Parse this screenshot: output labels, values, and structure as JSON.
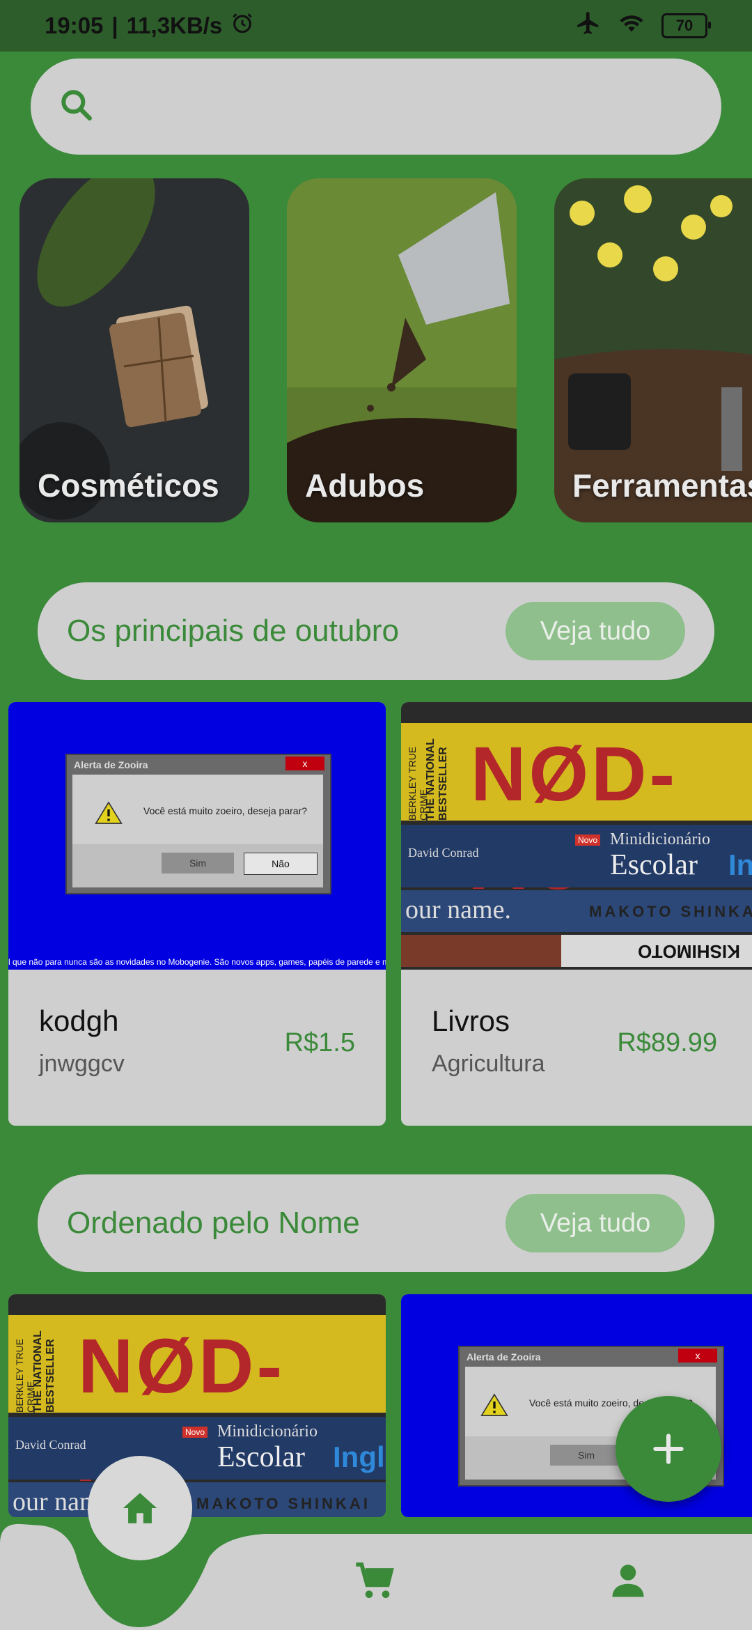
{
  "status_bar": {
    "time": "19:05",
    "speed": "11,3KB/s",
    "battery": "70",
    "icons": [
      "alarm-icon",
      "airplane-icon",
      "wifi-icon",
      "battery-icon"
    ]
  },
  "search": {
    "placeholder": "",
    "value": ""
  },
  "categories": [
    {
      "label": "Cosméticos"
    },
    {
      "label": "Adubos"
    },
    {
      "label": "Ferramentas"
    }
  ],
  "sections": [
    {
      "title": "Os principais de outubro",
      "see_all": "Veja tudo",
      "products": [
        {
          "name": "kodgh",
          "sub": "jnwggcv",
          "price": "R$1.5"
        },
        {
          "name": "Livros",
          "sub": "Agricultura",
          "price": "R$89.99"
        }
      ]
    },
    {
      "title": "Ordenado pelo Nome",
      "see_all": "Veja tudo"
    }
  ],
  "dialog_art": {
    "title": "Alerta de Zooira",
    "close": "x",
    "message": "Você está muito zoeiro, deseja parar?",
    "yes": "Sim",
    "no": "Não",
    "ticker": "l que não para nunca são as novidades no Mobogenie. São novos apps, games, papéis de parede e música todo dia!"
  },
  "books_art": {
    "spine1_tag": "BERKLEY TRUE CRIME",
    "spine1_banner": "THE NATIONAL BESTSELLER",
    "spine1_title": "NØD-AC",
    "spine2_author": "David Conrad",
    "spine2_badge": "Novo",
    "spine2_title": "Minidicionário",
    "spine2_big": "Escolar",
    "spine2_lang": "Inglê",
    "spine3_text": "our name.",
    "spine3_author": "MAKOTO SHINKAI",
    "spine4_text": "KISHIMOTO"
  },
  "colors": {
    "primary": "#3b8a3a",
    "surface": "#cfcfcf",
    "status_bar": "#2e5d2c"
  },
  "nav": {
    "items": [
      "home-icon",
      "cart-icon",
      "person-icon"
    ],
    "active": "home"
  },
  "fab": {
    "icon": "plus-icon"
  }
}
